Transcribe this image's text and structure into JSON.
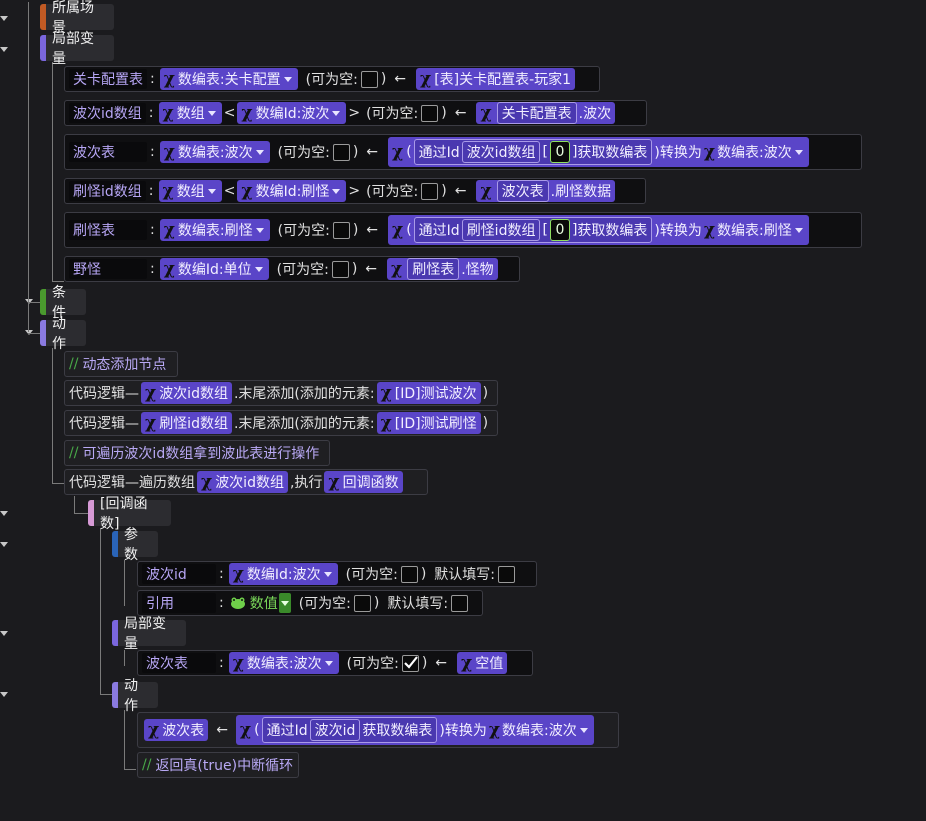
{
  "sections": {
    "scene": "所属场景",
    "locals": "局部变量",
    "conditions": "条件",
    "actions": "动作",
    "callback": "[回调函数]",
    "params": "参数",
    "cb_locals": "局部变量",
    "cb_actions": "动作"
  },
  "common": {
    "nullable": "(可为空:",
    "close": ")",
    "colon": ":",
    "arrow": "←",
    "default": "默认填写:",
    "lt": "<",
    "gt": ">",
    "paren_open": "(",
    "bracket_open": "[",
    "bracket_close": "]",
    "to_convert": ")转换为",
    "by_id": "通过Id",
    "get_table": "获取数编表"
  },
  "vars": [
    {
      "name": "关卡配置表",
      "type": "数编表:关卡配置",
      "value": "[表]关卡配置表-玩家1"
    },
    {
      "name": "波次id数组",
      "type": "数组",
      "elem": "数编Id:波次",
      "ref": "关卡配置表",
      "field": ".波次"
    },
    {
      "name": "波次表",
      "type": "数编表:波次",
      "src": "波次id数组",
      "idx": "0",
      "target": "数编表:波次"
    },
    {
      "name": "刷怪id数组",
      "type": "数组",
      "elem": "数编Id:刷怪",
      "ref": "波次表",
      "field": ".刷怪数据"
    },
    {
      "name": "刷怪表",
      "type": "数编表:刷怪",
      "src": "刷怪id数组",
      "idx": "0",
      "target": "数编表:刷怪"
    },
    {
      "name": "野怪",
      "type": "数编Id:单位",
      "ref": "刷怪表",
      "field": ".怪物"
    }
  ],
  "actions": {
    "comment1": "动态添加节点",
    "a1_prefix": "代码逻辑—",
    "a1_var": "波次id数组",
    "a1_mid": ".末尾添加(添加的元素:",
    "a1_val": "[ID]测试波次",
    "a2_var": "刷怪id数组",
    "a2_val": "[ID]测试刷怪",
    "comment2": "可遍历波次id数组拿到波此表进行操作",
    "loop_prefix": "代码逻辑—遍历数组",
    "loop_var": "波次id数组",
    "loop_mid": ",执行",
    "loop_cb": "回调函数"
  },
  "params": [
    {
      "name": "波次id",
      "type": "数编Id:波次"
    },
    {
      "name": "引用",
      "type": "数值"
    }
  ],
  "cb_local": {
    "name": "波次表",
    "type": "数编表:波次",
    "value": "空值"
  },
  "cb_action": {
    "target": "波次表",
    "src": "波次id",
    "conv": "数编表:波次"
  },
  "cb_comment": "返回真(true)中断循环",
  "icons": {
    "expr": "variable-x-icon",
    "numeric": "numeric-frog-icon",
    "check": "check-icon",
    "caret": "caret-down-icon",
    "comment": "comment-icon"
  },
  "colors": {
    "scene": "#c15a24",
    "locals": "#7a66dd",
    "conditions": "#4a9a2e",
    "actions": "#8a7ae0",
    "callback": "#d79ad6",
    "params": "#2a64b8",
    "chip": "#5a45c8",
    "comment": "#48a848"
  }
}
